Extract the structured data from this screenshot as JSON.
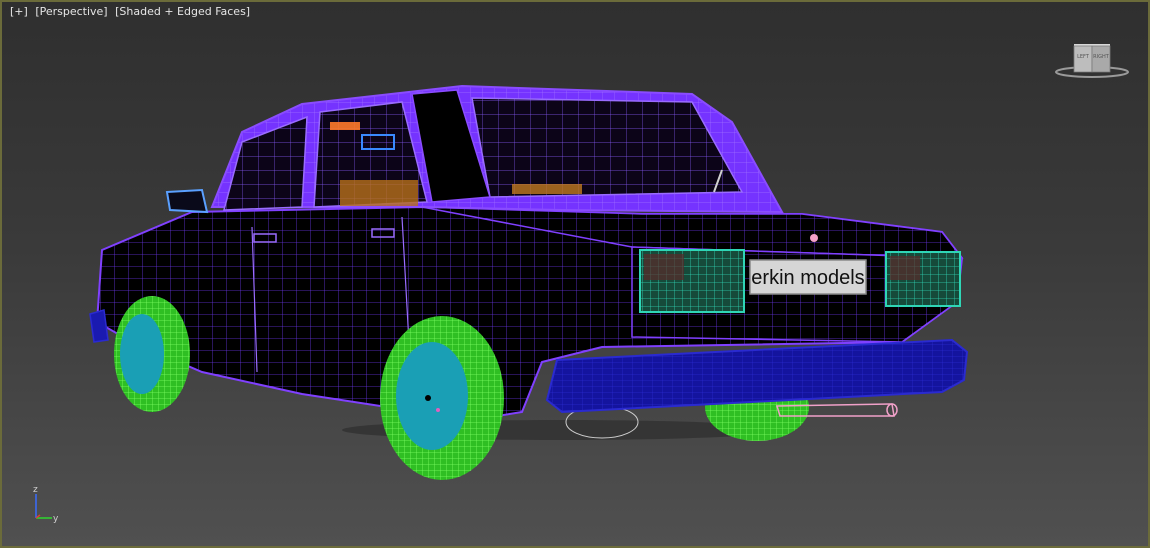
{
  "viewport": {
    "menu_label": "[+]",
    "view_label": "[Perspective]",
    "shading_label": "[Shaded + Edged Faces]"
  },
  "scene": {
    "plate_text": "erkin models"
  },
  "viewcube": {
    "left_face": "LEFT",
    "right_face": "RIGHT"
  },
  "axis": {
    "z_label": "z",
    "y_label": "y"
  },
  "colors": {
    "body_wire": "#7a3cff",
    "body_fill": "#000000",
    "tire": "#3ddc2a",
    "rim": "#1a9fb5",
    "bumper": "#1a1ab0",
    "taillight": "#19b39a",
    "exhaust": "#f0a0c8"
  }
}
